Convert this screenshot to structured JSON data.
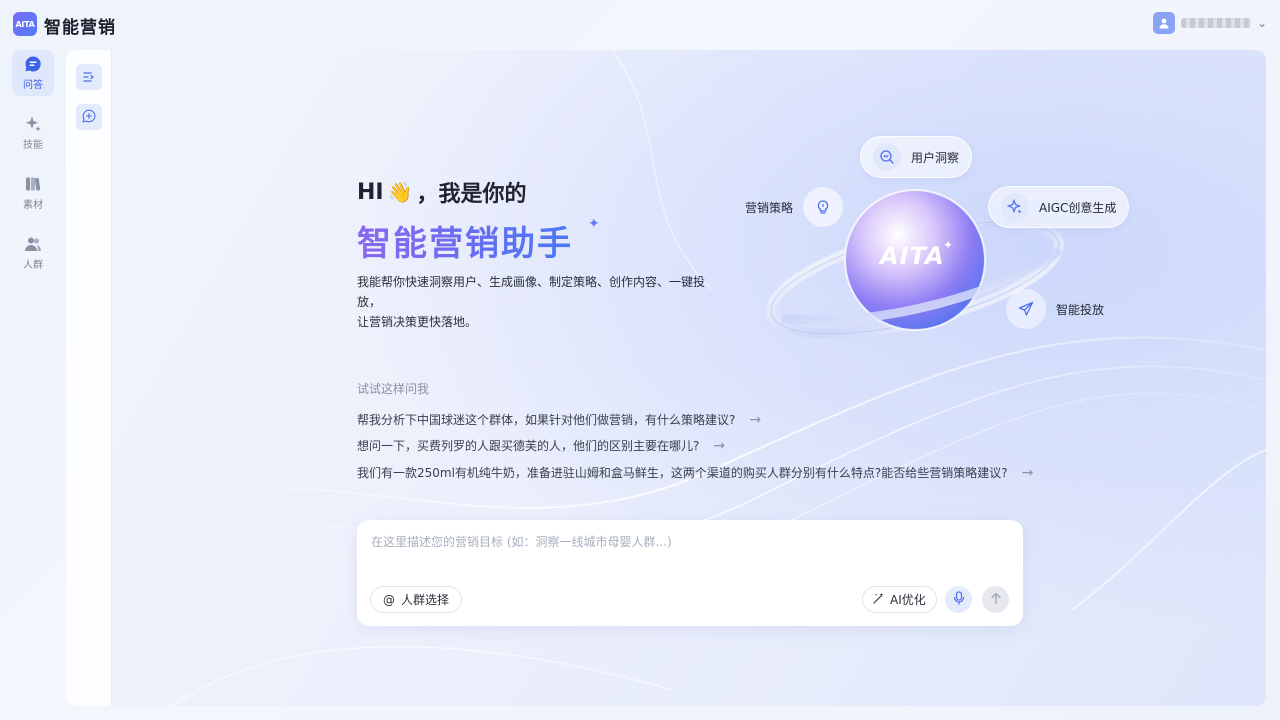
{
  "app": {
    "logo_text": "AITA",
    "title": "智能营销"
  },
  "nav": {
    "items": [
      {
        "label": "问答",
        "icon": "chat-icon",
        "active": true
      },
      {
        "label": "技能",
        "icon": "sparkle-icon",
        "active": false
      },
      {
        "label": "素材",
        "icon": "books-icon",
        "active": false
      },
      {
        "label": "人群",
        "icon": "people-icon",
        "active": false
      }
    ]
  },
  "hero": {
    "greeting": "HI",
    "hand": "👋",
    "greeting_tail": "，我是你的",
    "title": "智能营销助手",
    "description_line1": "我能帮你快速洞察用户、生成画像、制定策略、创作内容、一键投放，",
    "description_line2": "让营销决策更快落地。"
  },
  "illustration": {
    "center_text": "AITA",
    "chips": [
      {
        "label": "用户洞察",
        "icon": "insight-icon"
      },
      {
        "label": "营销策略",
        "icon": "bulb-icon"
      },
      {
        "label": "AIGC创意生成",
        "icon": "sparkle-icon"
      },
      {
        "label": "智能投放",
        "icon": "send-icon"
      }
    ]
  },
  "suggestions": {
    "label": "试试这样问我",
    "items": [
      "帮我分析下中国球迷这个群体，如果针对他们做营销，有什么策略建议?",
      "想问一下，买费列罗的人跟买德芙的人，他们的区别主要在哪儿?",
      "我们有一款250ml有机纯牛奶，准备进驻山姆和盒马鲜生，这两个渠道的购买人群分别有什么特点?能否给些营销策略建议?"
    ]
  },
  "composer": {
    "placeholder": "在这里描述您的营销目标 (如：洞察一线城市母婴人群...)",
    "audience_at": "@",
    "audience_label": "人群选择",
    "ai_label": "AI优化"
  },
  "colors": {
    "accent": "#4f6ef0",
    "brand_gradient_start": "#8b68f0",
    "brand_gradient_end": "#4a79f3"
  }
}
